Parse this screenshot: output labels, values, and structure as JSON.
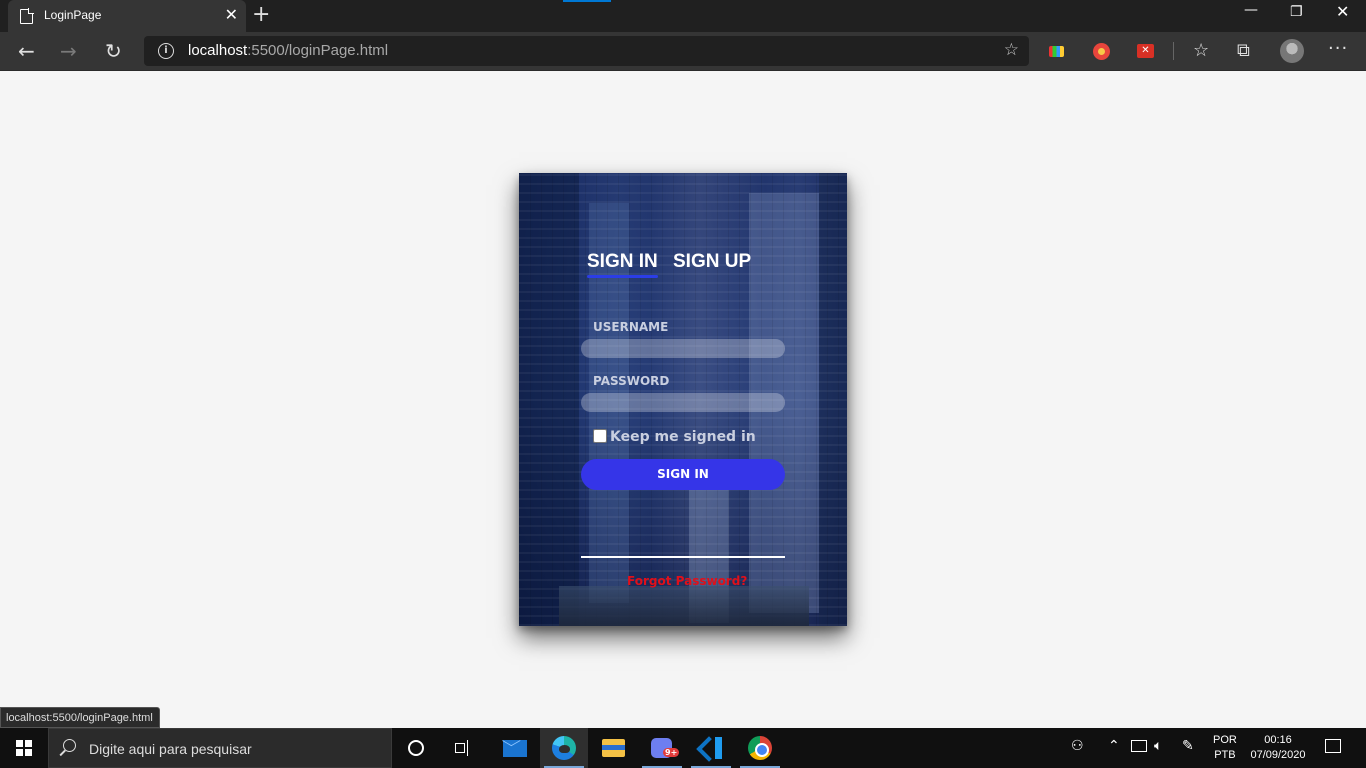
{
  "browser": {
    "tab_title": "LoginPage",
    "url_host": "localhost",
    "url_rest": ":5500/loginPage.html",
    "status_url": "localhost:5500/loginPage.html"
  },
  "login": {
    "tab_signin": "SIGN IN",
    "tab_signup": "SIGN UP",
    "username_label": "USERNAME",
    "username_value": "",
    "password_label": "PASSWORD",
    "password_value": "",
    "keep_signed_label": "Keep me signed in",
    "keep_signed_checked": false,
    "signin_button": "SIGN IN",
    "forgot_link": "Forgot Password?",
    "accent_color": "#3535e8",
    "forgot_color": "#e0101a"
  },
  "taskbar": {
    "search_placeholder": "Digite aqui para pesquisar",
    "discord_badge": "9+",
    "lang_line1": "POR",
    "lang_line2": "PTB",
    "time": "00:16",
    "date": "07/09/2020"
  }
}
